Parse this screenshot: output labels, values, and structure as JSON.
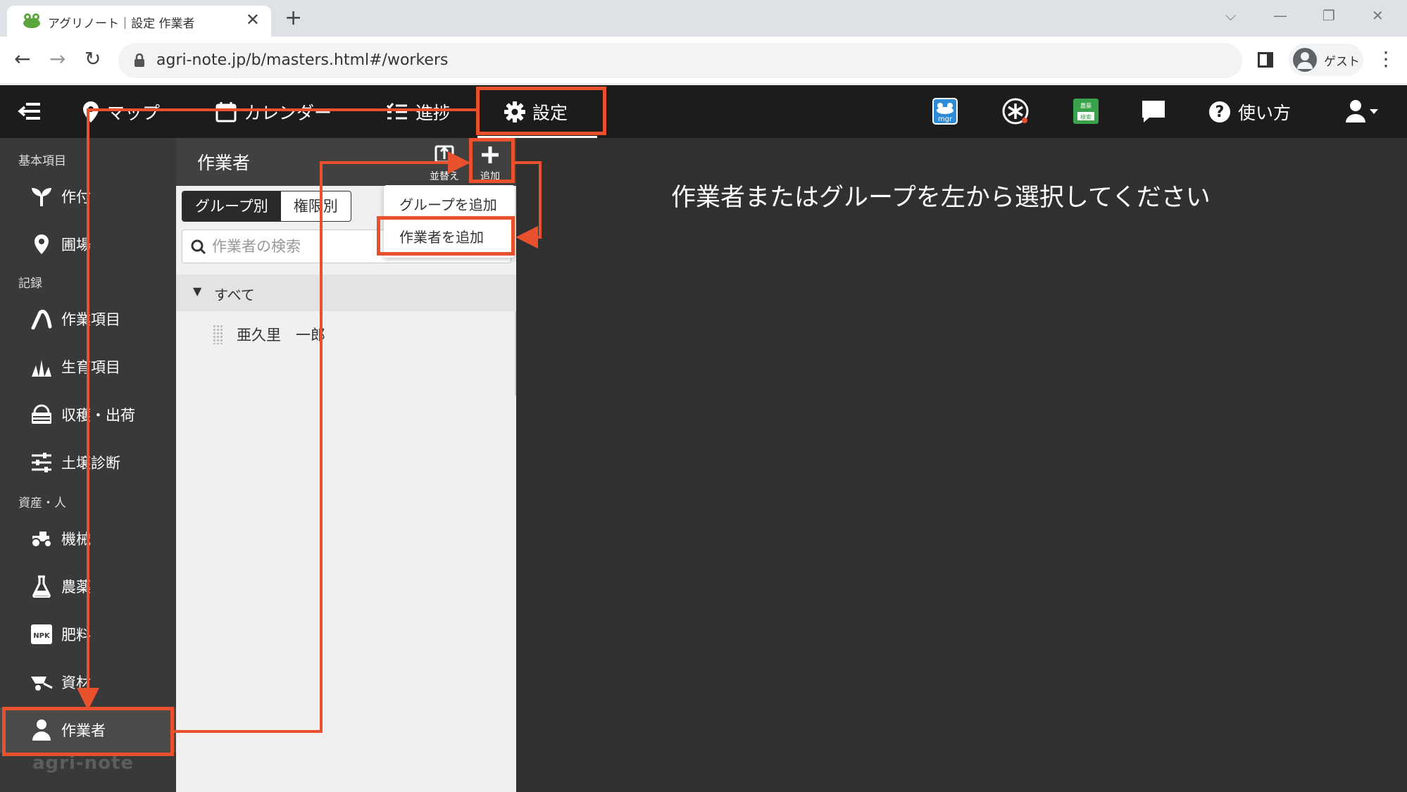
{
  "browser": {
    "tab_title": "アグリノート｜設定 作業者",
    "tab_close": "✕",
    "new_tab": "+",
    "url": "agri-note.jp/b/masters.html#/workers",
    "profile_label": "ゲスト",
    "back": "←",
    "forward": "→",
    "reload": "↻",
    "menu": "⋮",
    "win_collapse": "⌵",
    "win_minimize": "—",
    "win_restore": "❐",
    "win_close": "✕"
  },
  "header": {
    "menu_icon": "menu-collapse-icon",
    "nav": [
      {
        "label": "マップ",
        "icon": "map-pin-icon"
      },
      {
        "label": "カレンダー",
        "icon": "calendar-icon"
      },
      {
        "label": "進捗",
        "icon": "progress-list-icon"
      },
      {
        "label": "設定",
        "icon": "gear-icon"
      }
    ],
    "mgr_badge": "mgr",
    "registry_badge": "農薬\n検索",
    "help_label": "使い方"
  },
  "sidebar": {
    "sections": [
      {
        "label": "基本項目",
        "items": [
          {
            "label": "作付",
            "icon": "sprout-icon"
          },
          {
            "label": "圃場",
            "icon": "location-pin-icon"
          }
        ]
      },
      {
        "label": "記録",
        "items": [
          {
            "label": "作業項目",
            "icon": "hoe-icon"
          },
          {
            "label": "生育項目",
            "icon": "grass-icon"
          },
          {
            "label": "収穫・出荷",
            "icon": "basket-icon"
          },
          {
            "label": "土壌診断",
            "icon": "sliders-icon"
          }
        ]
      },
      {
        "label": "資産・人",
        "items": [
          {
            "label": "機械",
            "icon": "tractor-icon"
          },
          {
            "label": "農薬",
            "icon": "flask-icon"
          },
          {
            "label": "肥料",
            "icon": "npk-icon"
          },
          {
            "label": "資材",
            "icon": "wheelbarrow-icon"
          },
          {
            "label": "作業者",
            "icon": "person-icon"
          }
        ]
      }
    ],
    "brand": "agri-note"
  },
  "panel": {
    "title": "作業者",
    "sort_label": "並替え",
    "add_label": "追加",
    "tabs": [
      "グループ別",
      "権限別"
    ],
    "search_placeholder": "作業者の検索",
    "group_toggle": "▼",
    "group_label": "すべて",
    "workers": [
      "亜久里　一郎"
    ]
  },
  "dropdown": {
    "add_group": "グループを追加",
    "add_worker": "作業者を追加"
  },
  "content": {
    "message": "作業者またはグループを左から選択してください"
  },
  "colors": {
    "accent": "#e9502c",
    "appbar_bg": "#1c1c1c",
    "sidebar_bg": "#393939",
    "content_bg": "#303030",
    "panel_bg": "#f0f0f0"
  }
}
